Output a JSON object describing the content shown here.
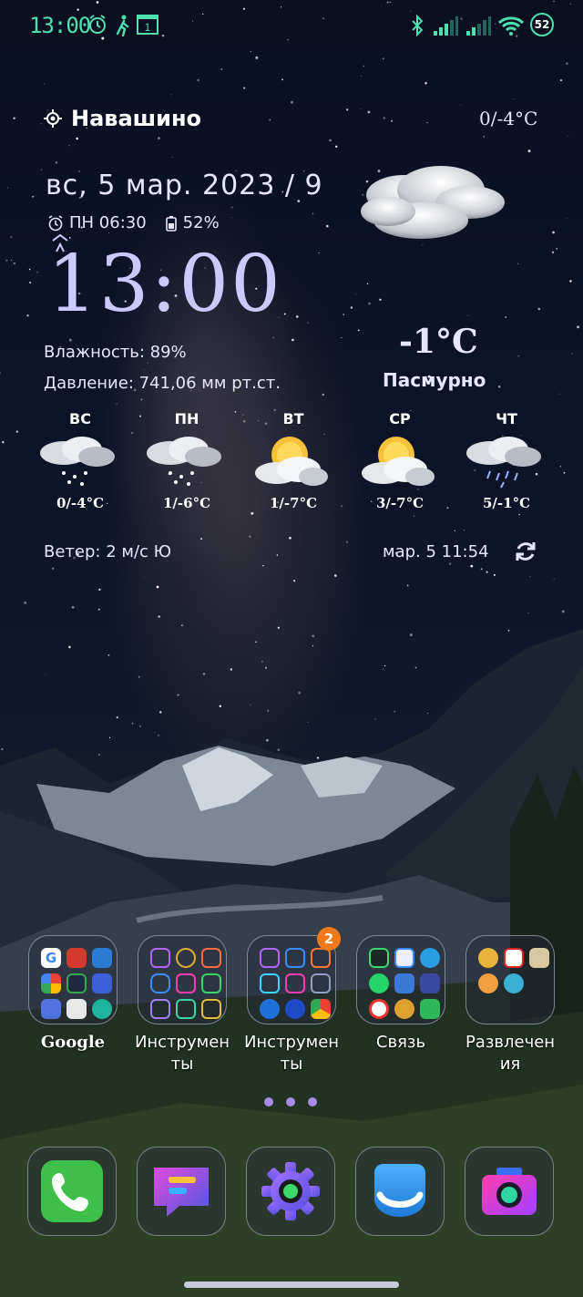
{
  "status_bar": {
    "time": "13:00",
    "icons": [
      "alarm-icon",
      "walking-icon",
      "sim-1-icon"
    ],
    "right_icons": [
      "bluetooth-icon",
      "signal-1-icon",
      "signal-2-icon",
      "wifi-icon",
      "battery-icon"
    ],
    "battery": "52",
    "accent_color": "#4fe0b0"
  },
  "weather": {
    "location": "Навашино",
    "range_today": "0/-4°C",
    "date": "вс, 5 мар. 2023 / 9",
    "alarm": "ПН 06:30",
    "battery": "52%",
    "clock": "13:00",
    "humidity": "Влажность: 89%",
    "pressure": "Давление: 741,06 мм рт.ст.",
    "current_temp": "-1°C",
    "condition": "Пасмурно",
    "wind": "Ветер: 2 м/с Ю",
    "updated": "мар. 5  11:54",
    "forecast": [
      {
        "day": "ВС",
        "temp": "0/-4°C",
        "icon": "snow-cloud-icon"
      },
      {
        "day": "ПН",
        "temp": "1/-6°C",
        "icon": "snow-cloud-icon"
      },
      {
        "day": "ВТ",
        "temp": "1/-7°C",
        "icon": "partly-cloudy-icon"
      },
      {
        "day": "СР",
        "temp": "3/-7°C",
        "icon": "partly-cloudy-icon"
      },
      {
        "day": "ЧТ",
        "temp": "5/-1°C",
        "icon": "rain-cloud-icon"
      }
    ]
  },
  "folders": [
    {
      "label": "Google",
      "badge": ""
    },
    {
      "label": "Инструмен\nты",
      "badge": ""
    },
    {
      "label": "Инструмен\nты",
      "badge": "2"
    },
    {
      "label": "Связь",
      "badge": ""
    },
    {
      "label": "Развлечен\nия",
      "badge": ""
    }
  ],
  "dock": [
    "phone-app-icon",
    "messages-app-icon",
    "settings-app-icon",
    "browser-app-icon",
    "camera-app-icon"
  ]
}
